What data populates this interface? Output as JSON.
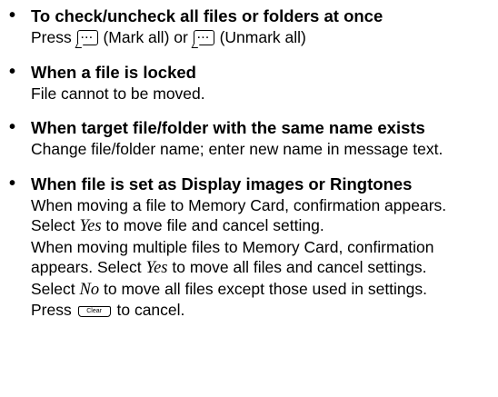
{
  "items": [
    {
      "heading": "To check/uncheck all files or folders at once",
      "line1": {
        "press": "Press",
        "mark_all": "(Mark all) or",
        "unmark_all": "(Unmark all)"
      }
    },
    {
      "heading": "When a file is locked",
      "line1": "File cannot to be moved."
    },
    {
      "heading": "When target file/folder with the same name exists",
      "line1": "Change file/folder name; enter new name in message text."
    },
    {
      "heading": "When file is set as Display images or Ringtones",
      "line1": "When moving a file to Memory Card, confirmation appears.",
      "line2_before": "Select",
      "line2_yes": "Yes",
      "line2_after": "to move file and cancel setting.",
      "line3": "When moving multiple files to Memory Card, confirmation",
      "line4_before": "appears. Select",
      "line4_yes": "Yes",
      "line4_after": "to move all files and cancel settings.",
      "line5_before": "Select",
      "line5_no": "No",
      "line5_after": "to move all files except those used in settings.",
      "line6_before": "Press",
      "line6_key": "Clear",
      "line6_after": "to cancel."
    }
  ],
  "icons": {
    "softkey": "menu-softkey-icon",
    "clear": "clear-key-icon"
  }
}
